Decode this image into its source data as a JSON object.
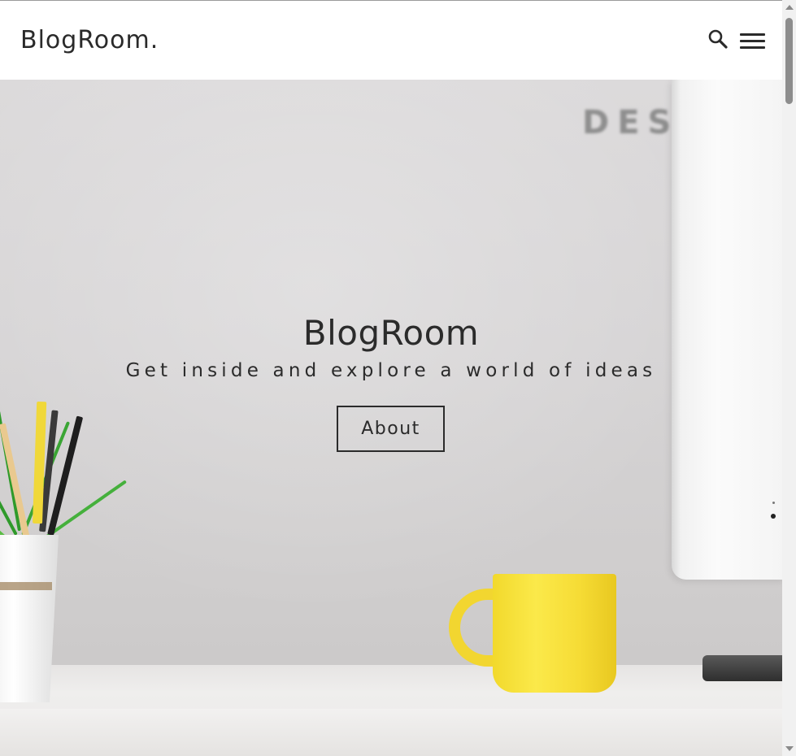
{
  "header": {
    "logo_text": "BlogRoom.",
    "search_icon": "search-icon",
    "menu_icon": "hamburger-menu-icon"
  },
  "hero": {
    "title": "BlogRoom",
    "subtitle": "Get inside and explore a world of ideas",
    "button_label": "About",
    "background_text": "DES"
  },
  "colors": {
    "text": "#2b2b2b",
    "header_bg": "#ffffff",
    "mug_yellow": "#f8e23a"
  }
}
